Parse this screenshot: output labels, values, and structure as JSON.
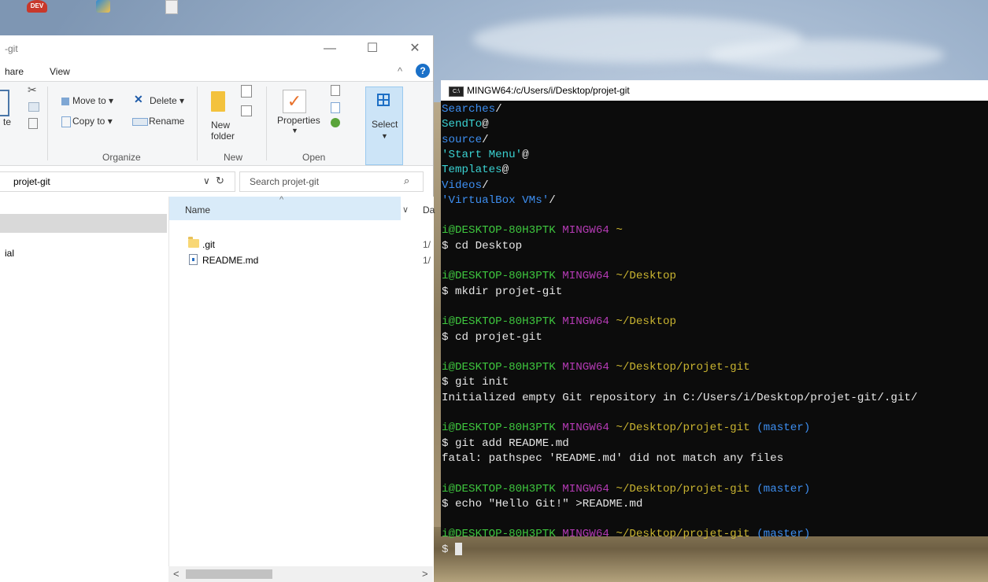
{
  "explorer": {
    "title": "-git",
    "menu": {
      "share": "hare",
      "view": "View"
    },
    "ribbon": {
      "paste_partial": "te",
      "move_to": "Move to",
      "copy_to": "Copy to",
      "delete": "Delete",
      "rename": "Rename",
      "new_folder_line1": "New",
      "new_folder_line2": "folder",
      "properties": "Properties",
      "select": "Select",
      "groups": {
        "organize": "Organize",
        "new": "New",
        "open": "Open"
      }
    },
    "address": "projet-git",
    "search_placeholder": "Search projet-git",
    "nav": {
      "partial_item": "ial"
    },
    "columns": {
      "name": "Name",
      "date": "Da"
    },
    "files": [
      {
        "name": ".git",
        "date": "1/",
        "type": "folder"
      },
      {
        "name": "README.md",
        "date": "1/",
        "type": "file"
      }
    ]
  },
  "terminal": {
    "title": "MINGW64:/c/Users/i/Desktop/projet-git",
    "lines": [
      {
        "segments": [
          {
            "text": "Searches",
            "color": "blue"
          },
          {
            "text": "/",
            "color": "white"
          }
        ]
      },
      {
        "segments": [
          {
            "text": "SendTo",
            "color": "cyan"
          },
          {
            "text": "@",
            "color": "white"
          }
        ]
      },
      {
        "segments": [
          {
            "text": "source",
            "color": "blue"
          },
          {
            "text": "/",
            "color": "white"
          }
        ]
      },
      {
        "segments": [
          {
            "text": "'Start Menu'",
            "color": "cyan"
          },
          {
            "text": "@",
            "color": "white"
          }
        ]
      },
      {
        "segments": [
          {
            "text": "Templates",
            "color": "cyan"
          },
          {
            "text": "@",
            "color": "white"
          }
        ]
      },
      {
        "segments": [
          {
            "text": "Videos",
            "color": "blue"
          },
          {
            "text": "/",
            "color": "white"
          }
        ]
      },
      {
        "segments": [
          {
            "text": "'VirtualBox VMs'",
            "color": "blue"
          },
          {
            "text": "/",
            "color": "white"
          }
        ]
      },
      {
        "segments": []
      },
      {
        "segments": [
          {
            "text": "i@DESKTOP-80H3PTK ",
            "color": "green"
          },
          {
            "text": "MINGW64 ",
            "color": "magenta"
          },
          {
            "text": "~",
            "color": "yellow"
          }
        ]
      },
      {
        "segments": [
          {
            "text": "$ cd Desktop",
            "color": "white"
          }
        ]
      },
      {
        "segments": []
      },
      {
        "segments": [
          {
            "text": "i@DESKTOP-80H3PTK ",
            "color": "green"
          },
          {
            "text": "MINGW64 ",
            "color": "magenta"
          },
          {
            "text": "~/Desktop",
            "color": "yellow"
          }
        ]
      },
      {
        "segments": [
          {
            "text": "$ mkdir projet-git",
            "color": "white"
          }
        ]
      },
      {
        "segments": []
      },
      {
        "segments": [
          {
            "text": "i@DESKTOP-80H3PTK ",
            "color": "green"
          },
          {
            "text": "MINGW64 ",
            "color": "magenta"
          },
          {
            "text": "~/Desktop",
            "color": "yellow"
          }
        ]
      },
      {
        "segments": [
          {
            "text": "$ cd projet-git",
            "color": "white"
          }
        ]
      },
      {
        "segments": []
      },
      {
        "segments": [
          {
            "text": "i@DESKTOP-80H3PTK ",
            "color": "green"
          },
          {
            "text": "MINGW64 ",
            "color": "magenta"
          },
          {
            "text": "~/Desktop/projet-git",
            "color": "yellow"
          }
        ]
      },
      {
        "segments": [
          {
            "text": "$ git init",
            "color": "white"
          }
        ]
      },
      {
        "segments": [
          {
            "text": "Initialized empty Git repository in C:/Users/i/Desktop/projet-git/.git/",
            "color": "white"
          }
        ]
      },
      {
        "segments": []
      },
      {
        "segments": [
          {
            "text": "i@DESKTOP-80H3PTK ",
            "color": "green"
          },
          {
            "text": "MINGW64 ",
            "color": "magenta"
          },
          {
            "text": "~/Desktop/projet-git ",
            "color": "yellow"
          },
          {
            "text": "(master)",
            "color": "branch"
          }
        ]
      },
      {
        "segments": [
          {
            "text": "$ git add README.md",
            "color": "white"
          }
        ]
      },
      {
        "segments": [
          {
            "text": "fatal: pathspec 'README.md' did not match any files",
            "color": "white"
          }
        ]
      },
      {
        "segments": []
      },
      {
        "segments": [
          {
            "text": "i@DESKTOP-80H3PTK ",
            "color": "green"
          },
          {
            "text": "MINGW64 ",
            "color": "magenta"
          },
          {
            "text": "~/Desktop/projet-git ",
            "color": "yellow"
          },
          {
            "text": "(master)",
            "color": "branch"
          }
        ]
      },
      {
        "segments": [
          {
            "text": "$ echo \"Hello Git!\" >README.md",
            "color": "white"
          }
        ]
      },
      {
        "segments": []
      },
      {
        "segments": [
          {
            "text": "i@DESKTOP-80H3PTK ",
            "color": "green"
          },
          {
            "text": "MINGW64 ",
            "color": "magenta"
          },
          {
            "text": "~/Desktop/projet-git ",
            "color": "yellow"
          },
          {
            "text": "(master)",
            "color": "branch"
          }
        ]
      },
      {
        "segments": [
          {
            "text": "$ ",
            "color": "white"
          }
        ],
        "cursor": true
      }
    ]
  },
  "desktop_icons": [
    "dev-cpp-icon",
    "virtualbox-icon",
    "document-icon"
  ]
}
